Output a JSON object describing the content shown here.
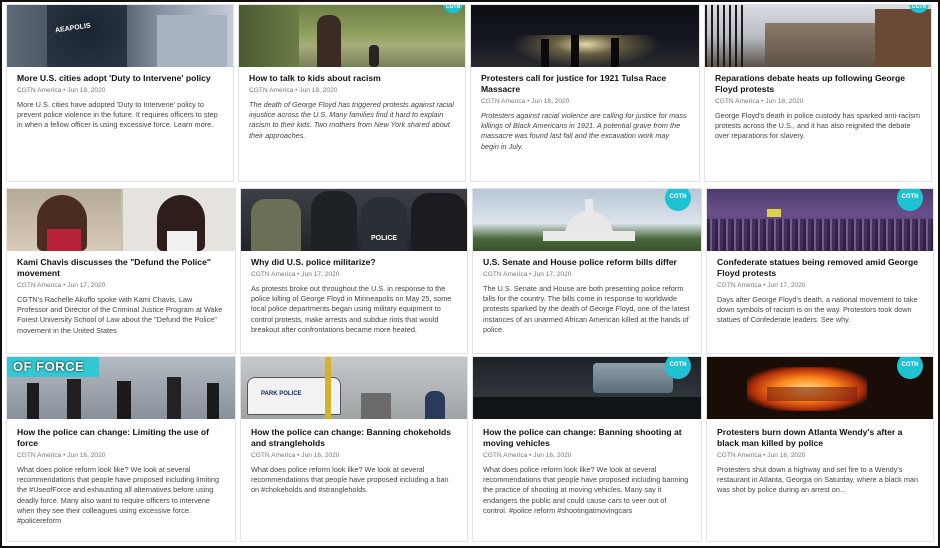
{
  "logo_text": "CGTN",
  "cards": [
    {
      "title": "More U.S. cities adopt 'Duty to Intervene' policy",
      "meta": "CGTN America • Jun 18, 2020",
      "desc": "More U.S. cities have adopted 'Duty to Intervene' policy to prevent police violence in the future. It requires officers to step in when a fellow officer is using excessive force. Learn more.",
      "thumb_text": "AEAPOLIS"
    },
    {
      "title": "How to talk to kids about racism",
      "meta": "CGTN America • Jun 18, 2020",
      "desc": "The death of George Floyd has triggered protests against racial injustice across the U.S. Many families find it hard to explain racism to their kids. Two mothers from New York shared about their approaches."
    },
    {
      "title": "Protesters call for justice for 1921 Tulsa Race Massacre",
      "meta": "CGTN America • Jun 18, 2020",
      "desc": "Protesters against racial violence are calling for justice for mass killings of Black Americans in 1921. A potential grave from the massacre was found last fall and the excavation work may begin in July."
    },
    {
      "title": "Reparations debate heats up following George Floyd protests",
      "meta": "CGTN America • Jun 18, 2020",
      "desc": "George Floyd's death in police custody has sparked anti-racism protests across the U.S., and it has also reignited the debate over reparations for slavery."
    },
    {
      "title": "Kami Chavis discusses the \"Defund the Police\" movement",
      "meta": "CGTN America • Jun 17, 2020",
      "desc": "CGTN's Rachelle Akuffo spoke with Kami Chavis, Law Professor and Director of the Criminal Justice Program at Wake Forest University School of Law about the \"Defund the Police\" movement in the United States"
    },
    {
      "title": "Why did U.S. police militarize?",
      "meta": "CGTN America • Jun 17, 2020",
      "desc": "As protests broke out throughout the U.S. in response to the police killing of George Floyd in Minneapolis on May 25, some local police departments began using military equipment to control protests, make arrests and subdue riots that would breakout after confrontations became more heated.",
      "thumb_text": "POLICE"
    },
    {
      "title": "U.S. Senate and House police reform bills differ",
      "meta": "CGTN America • Jun 17, 2020",
      "desc": "The U.S. Senate and House are both presenting police reform bills for the country. The bills come in response to worldwide protests sparked by the death of George Floyd, one of the latest instances of an unarmed African American killed at the hands of police."
    },
    {
      "title": "Confederate statues being removed amid George Floyd protests",
      "meta": "CGTN America • Jun 17, 2020",
      "desc": "Days after George Floyd's death, a national movement to take down symbols of racism is on the way. Protestors took down statues of Confederate leaders. See why."
    },
    {
      "title": "How the police can change: Limiting the use of force",
      "meta": "CGTN America • Jun 16, 2020",
      "desc": "What does police reform look like? We look at several recommendations that people have proposed including limiting the #UseofForce and exhausting all alternatives before using deadly force. Many also want to require officers to intervene when they see their colleagues using excessive force. #policereform",
      "thumb_text": "OF FORCE"
    },
    {
      "title": "How the police can change: Banning chokeholds and strangleholds",
      "meta": "CGTN America • Jun 16, 2020",
      "desc": "What does police reform look like? We look at several recommendations that people have proposed including a ban on #chokeholds and #strangleholds.",
      "thumb_text": "PARK POLICE"
    },
    {
      "title": "How the police can change: Banning shooting at moving vehicles",
      "meta": "CGTN America • Jun 16, 2020",
      "desc": "What does police reform look like? We look at several recommendations that people have proposed including banning the practice of shooting at moving vehicles. Many say it endangers the public and could cause cars to veer out of control. #police reform #shootingatmovingcars"
    },
    {
      "title": "Protesters burn down Atlanta Wendy's after a black man killed by police",
      "meta": "CGTN America • Jun 16, 2020",
      "desc": "Protesters shut down a highway and set fire to a Wendy's restaurant in Atlanta, Georgia on Saturday, where a black man was shot by police during an arrest on..."
    }
  ]
}
